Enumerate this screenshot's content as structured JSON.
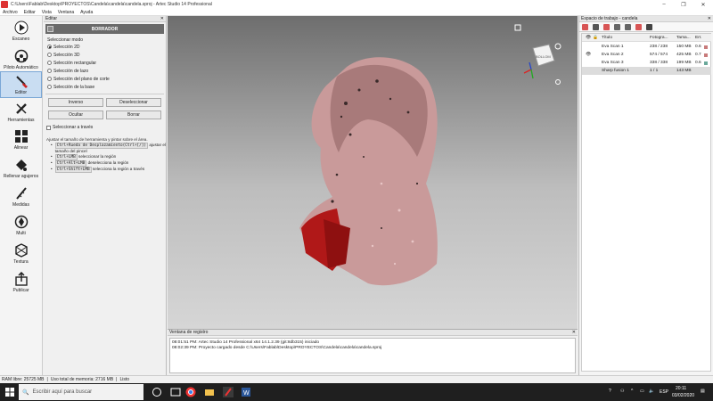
{
  "window": {
    "title": "C:\\Users\\Fablab\\Desktop\\PROYECTOS\\Candela\\candela\\candela.sproj - Artec Studio 14 Professional",
    "minimize": "–",
    "maximize": "❐",
    "close": "✕"
  },
  "menu": [
    "Archivo",
    "Editar",
    "Vista",
    "Ventana",
    "Ayuda"
  ],
  "toolbar": [
    {
      "label": "Escaneo",
      "icon": "scan-icon"
    },
    {
      "label": "Piloto Automático",
      "icon": "autopilot-icon"
    },
    {
      "label": "Editor",
      "icon": "eraser-icon",
      "active": true
    },
    {
      "label": "Herramientas",
      "icon": "tools-icon"
    },
    {
      "label": "Alinear",
      "icon": "align-icon"
    },
    {
      "label": "Rellenar agujeros",
      "icon": "fill-holes-icon"
    },
    {
      "label": "Medidas",
      "icon": "measure-icon"
    },
    {
      "label": "Multi",
      "icon": "multi-icon"
    },
    {
      "label": "Textura",
      "icon": "texture-icon"
    },
    {
      "label": "Publicar",
      "icon": "publish-icon"
    }
  ],
  "editor": {
    "panel_title": "Editar",
    "tool_title": "BORRADOR",
    "mode_label": "Seleccionar modo",
    "modes": [
      {
        "label": "Selección 2D",
        "selected": true
      },
      {
        "label": "Selección 3D",
        "selected": false
      },
      {
        "label": "Selección rectangular",
        "selected": false
      },
      {
        "label": "Selección de lazo",
        "selected": false
      },
      {
        "label": "Selección del plano de corte",
        "selected": false
      },
      {
        "label": "Selección de la base",
        "selected": false
      }
    ],
    "invert_label": "Inverso",
    "deselect_label": "Deseleccionar",
    "hide_label": "Ocultar",
    "delete_label": "Borrar",
    "through_label": "Seleccionar a través",
    "help_intro": "Ajustar el tamaño de herramienta y pintar sobre el área.",
    "help_items": [
      {
        "key": "Ctrl+Rueda de Desplazamiento(Ctrl+[/])",
        "text": "ajustar el tamaño del pincel"
      },
      {
        "key": "Ctrl+LMB",
        "text": "seleccionar la región"
      },
      {
        "key": "Ctrl+Alt+LMB",
        "text": "deselecciona la región"
      },
      {
        "key": "Ctrl+Shift+LMB",
        "text": "selecciona la región a través"
      }
    ]
  },
  "viewport": {
    "cube_label": "BOLLOM"
  },
  "log": {
    "title": "Ventana de registro",
    "lines": [
      "08:01:51 PM: Artec Studio 14 Professional x64 14.1.2.39 (git:8db315) iniciado",
      "08:02:39 PM: Proyecto cargado desde C:\\Users\\Fablab\\Desktop\\PROYECTOS\\Candela\\candela\\candela.sproj"
    ]
  },
  "workspace": {
    "title": "Espacio de trabajo - candela",
    "columns": [
      "Título",
      "Fotogra...",
      "Tama...",
      "Err."
    ],
    "rows": [
      {
        "title": "Eva Scan 1",
        "frames": "238 / 238",
        "size": "150 MB",
        "err": "0.6",
        "color": "#c87b7b",
        "visible": true,
        "selected": false
      },
      {
        "title": "Eva Scan 2",
        "frames": "574 / 574",
        "size": "425 MB",
        "err": "0.7",
        "color": "#c87b7b",
        "visible": true,
        "selected": false
      },
      {
        "title": "Eva Scan 3",
        "frames": "338 / 338",
        "size": "199 MB",
        "err": "0.6",
        "color": "#6aa89a",
        "visible": false,
        "selected": false
      },
      {
        "title": "Sharp fusion 1",
        "frames": "1 / 1",
        "size": "143 MB",
        "err": "",
        "color": "",
        "visible": false,
        "selected": true
      }
    ]
  },
  "status": {
    "ram": "RAM libre: 25725 MB",
    "memory": "Uso total de memoria: 2716 MB",
    "state": "Listo"
  },
  "taskbar": {
    "search_placeholder": "Escribir aquí para buscar",
    "lang": "ESP",
    "time": "20:11",
    "date": "03/02/2020"
  },
  "colors": {
    "scan_pink": "#c99a9a",
    "scan_red": "#b01818",
    "viewport_top": "#6e6e6e",
    "viewport_bottom": "#d6d6d6",
    "active_tool": "#c9ddf2"
  }
}
